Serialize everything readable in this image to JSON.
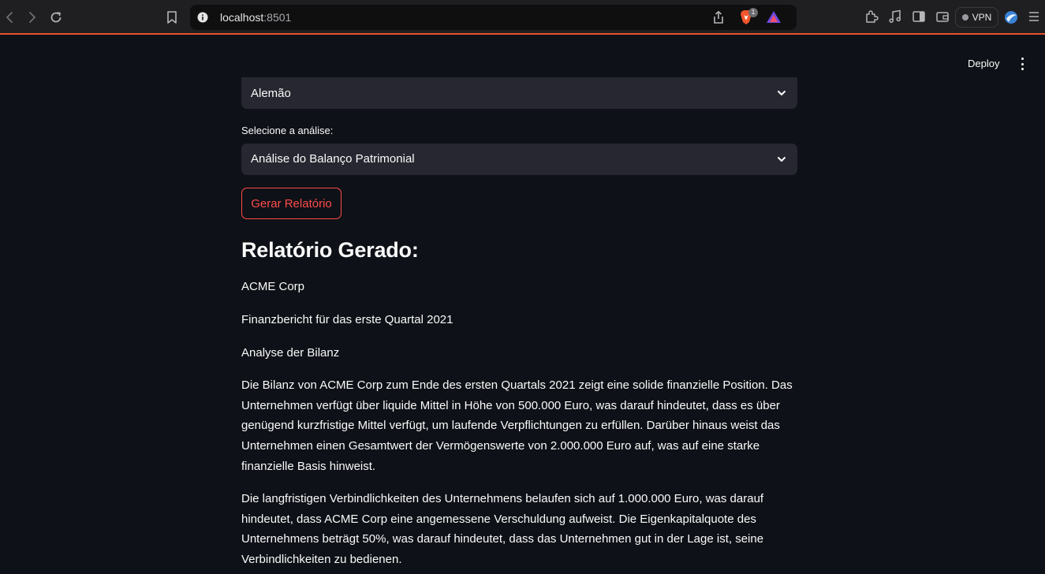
{
  "browser": {
    "url_host": "localhost",
    "url_port": ":8501",
    "brave_badge": "1",
    "vpn_label": "VPN"
  },
  "app": {
    "deploy_label": "Deploy",
    "language_select": {
      "value": "Alemão"
    },
    "analysis_label": "Selecione a análise:",
    "analysis_select": {
      "value": "Análise do Balanço Patrimonial"
    },
    "generate_button": "Gerar Relatório",
    "report_heading": "Relatório Gerado:",
    "report": {
      "company": "ACME Corp",
      "subtitle": "Finanzbericht für das erste Quartal 2021",
      "section": "Analyse der Bilanz",
      "paragraph1": "Die Bilanz von ACME Corp zum Ende des ersten Quartals 2021 zeigt eine solide finanzielle Position. Das Unternehmen verfügt über liquide Mittel in Höhe von 500.000 Euro, was darauf hindeutet, dass es über genügend kurzfristige Mittel verfügt, um laufende Verpflichtungen zu erfüllen. Darüber hinaus weist das Unternehmen einen Gesamtwert der Vermögenswerte von 2.000.000 Euro auf, was auf eine starke finanzielle Basis hinweist.",
      "paragraph2": "Die langfristigen Verbindlichkeiten des Unternehmens belaufen sich auf 1.000.000 Euro, was darauf hindeutet, dass ACME Corp eine angemessene Verschuldung aufweist. Die Eigenkapitalquote des Unternehmens beträgt 50%, was darauf hindeutet, dass das Unternehmen gut in der Lage ist, seine Verbindlichkeiten zu bedienen."
    }
  }
}
